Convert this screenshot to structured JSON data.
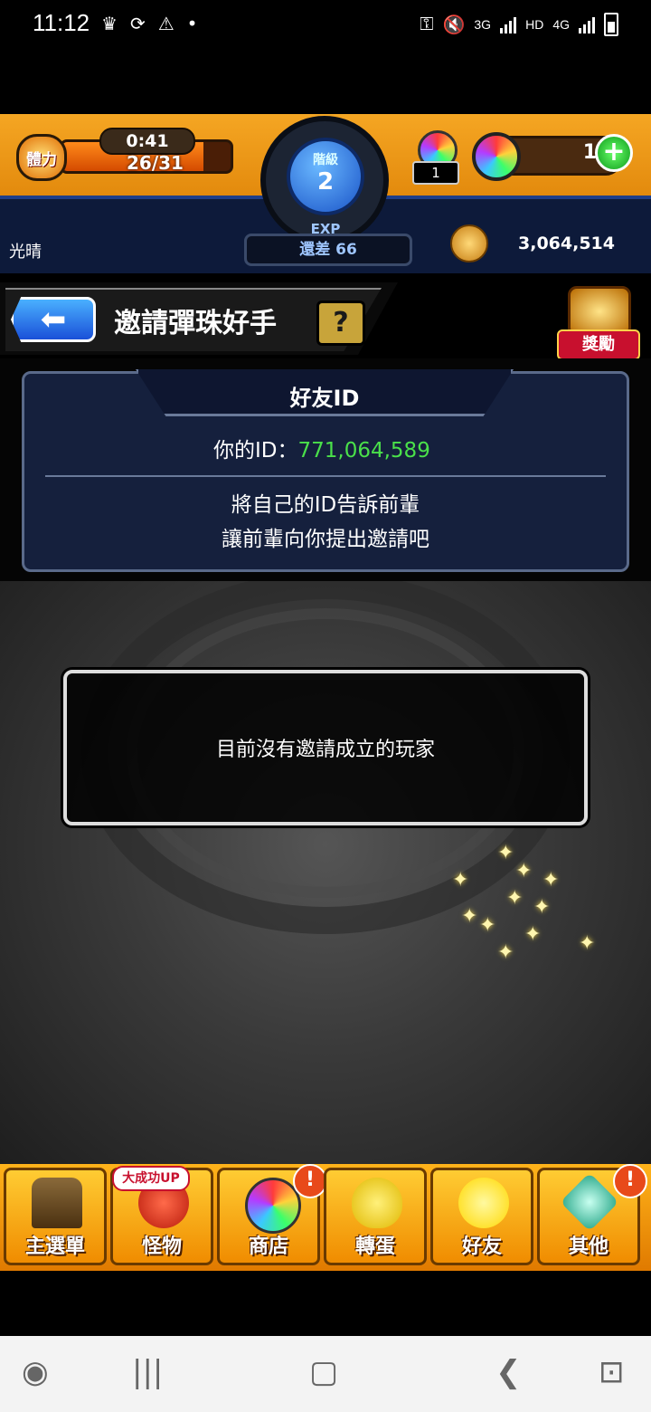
{
  "status_bar": {
    "time": "11:12",
    "network_3g": "3G",
    "hd": "HD",
    "network_4g": "4G"
  },
  "hud": {
    "stamina_label": "體力",
    "stamina_timer": "0:41",
    "stamina_value": "26/31",
    "stamina_fraction": 0.84,
    "rank_label": "階級",
    "rank_value": "2",
    "exp_label": "EXP",
    "exp_remaining": "還差 66",
    "orb_item_count": "1",
    "orb_count": "1",
    "player_name": "光晴",
    "coins": "3,064,514"
  },
  "header": {
    "title": "邀請彈珠好手",
    "help": "?",
    "reward_label": "獎勵"
  },
  "friend_panel": {
    "tab_title": "好友ID",
    "id_label": "你的ID：",
    "id_value": "771,064,589",
    "desc_line1": "將自己的ID告訴前輩",
    "desc_line2": "讓前輩向你提出邀請吧"
  },
  "main": {
    "empty_message": "目前沒有邀請成立的玩家"
  },
  "bottom_nav": {
    "promo": "大成功UP",
    "items": [
      {
        "label": "主選單",
        "icon": "gate-icon"
      },
      {
        "label": "怪物",
        "icon": "monster-icon"
      },
      {
        "label": "商店",
        "icon": "rainbow-orb-icon"
      },
      {
        "label": "轉蛋",
        "icon": "egg-icon"
      },
      {
        "label": "好友",
        "icon": "friends-icon"
      },
      {
        "label": "其他",
        "icon": "question-icon"
      }
    ],
    "alert": "!"
  },
  "colors": {
    "hud_orange": "#f5a623",
    "panel_navy": "#15203d",
    "id_green": "#4ae04a",
    "nav_orange": "#ffb31a"
  }
}
